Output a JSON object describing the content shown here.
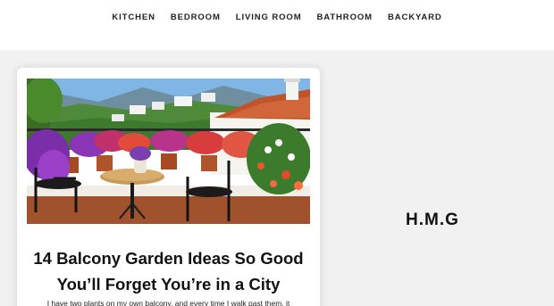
{
  "nav": {
    "items": [
      "KITCHEN",
      "BEDROOM",
      "LIVING ROOM",
      "BATHROOM",
      "BACKYARD"
    ]
  },
  "article": {
    "title_line1": "14 Balcony Garden Ideas So Good",
    "title_line2": "You’ll Forget You’re in a City",
    "excerpt": "I have two plants on my own balcony, and every time I walk past them, it"
  },
  "sidebar": {
    "logo": "H.M.G"
  },
  "colors": {
    "nav_text": "#222222",
    "page_bg": "#f1f1f1",
    "card_bg": "#ffffff"
  }
}
